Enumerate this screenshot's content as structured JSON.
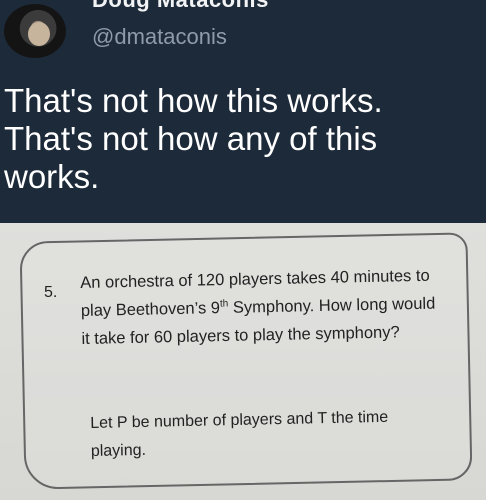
{
  "tweet": {
    "display_name": "Doug Mataconis",
    "handle": "@dmataconis",
    "text_line1": "That's not how this works.",
    "text_line2": "That's not how any of this",
    "text_line3": "works."
  },
  "worksheet": {
    "number": "5.",
    "question_part1": "An orchestra of 120 players takes 40 minutes to play Beethoven’s 9",
    "question_sup": "th",
    "question_part2": "Symphony. How long would it take for 60 players to play the symphony?",
    "hint": "Let P be number of players and T the time playing."
  }
}
